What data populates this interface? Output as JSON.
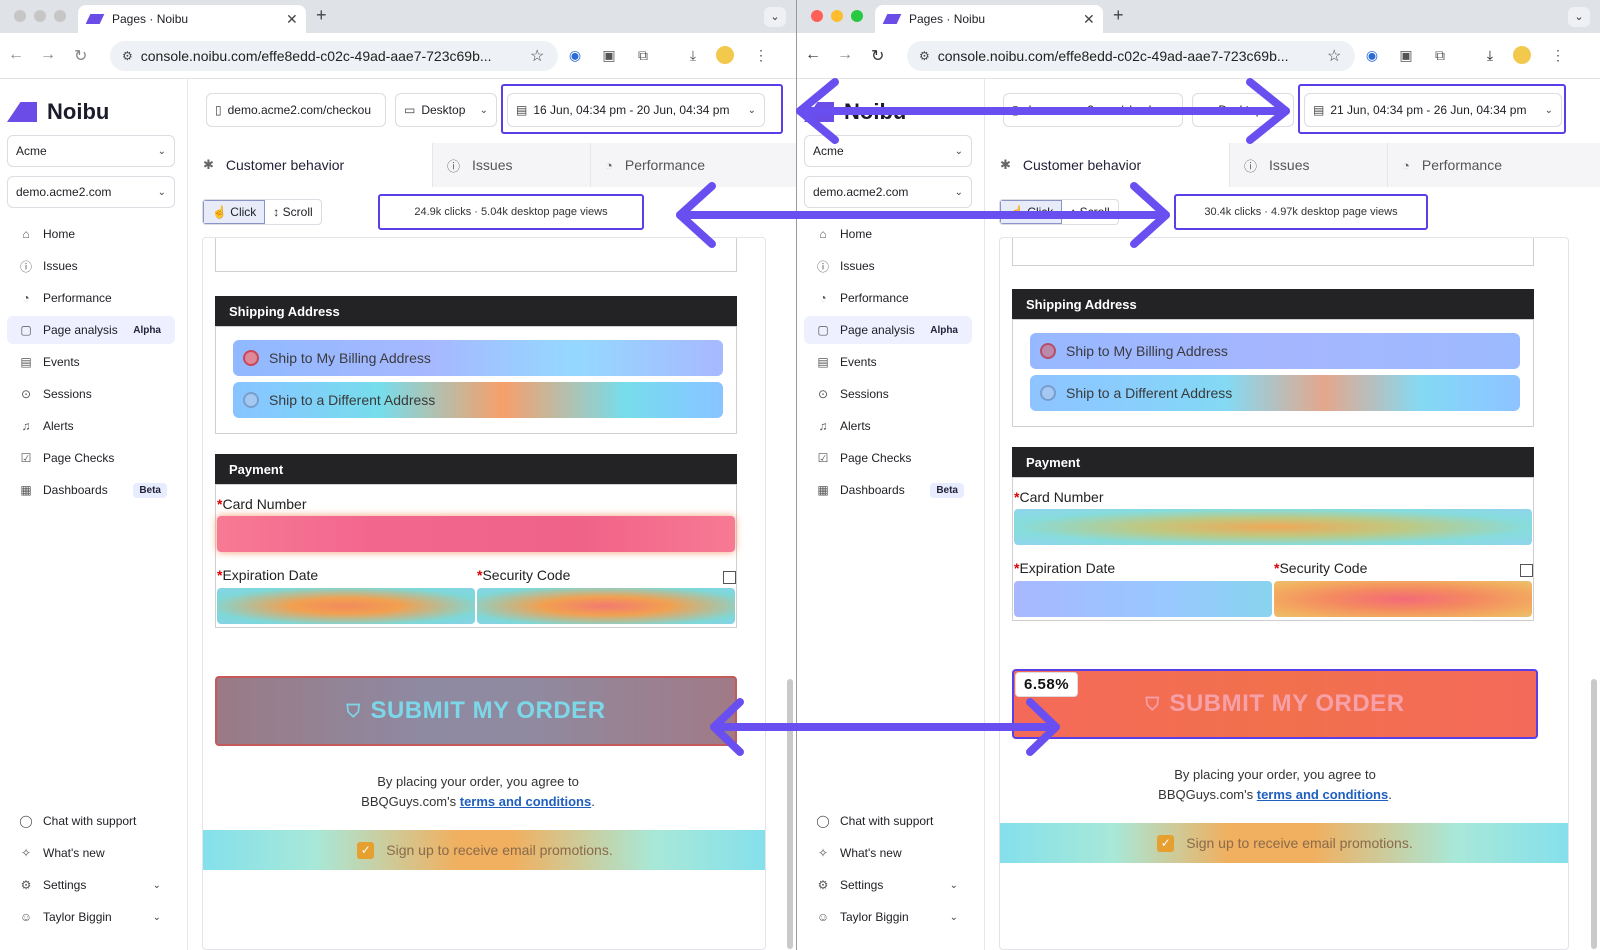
{
  "browser": {
    "tab_title": "Pages · Noibu",
    "tab_close": "✕",
    "new_tab": "+",
    "url": "console.noibu.com/effe8edd-c02c-49ad-aae7-723c69b..."
  },
  "sidebar": {
    "logo_text": "Noibu",
    "org_select": "Acme",
    "site_select": "demo.acme2.com",
    "nav": [
      {
        "label": "Home",
        "icon": "home-icon"
      },
      {
        "label": "Issues",
        "icon": "alert-circle-icon"
      },
      {
        "label": "Performance",
        "icon": "gauge-icon"
      },
      {
        "label": "Page analysis",
        "icon": "page-icon",
        "badge": "Alpha"
      },
      {
        "label": "Events",
        "icon": "calendar-icon"
      },
      {
        "label": "Sessions",
        "icon": "play-icon"
      },
      {
        "label": "Alerts",
        "icon": "bell-icon"
      },
      {
        "label": "Page Checks",
        "icon": "checklist-icon"
      },
      {
        "label": "Dashboards",
        "icon": "dashboard-icon",
        "badge": "Beta"
      }
    ],
    "bottom": [
      {
        "label": "Chat with support",
        "icon": "chat-icon"
      },
      {
        "label": "What's new",
        "icon": "sparkle-icon"
      },
      {
        "label": "Settings",
        "icon": "gear-icon"
      },
      {
        "label": "Taylor Biggin",
        "icon": "user-icon"
      }
    ]
  },
  "header": {
    "page_filter": "demo.acme2.com/checkou",
    "device_filter": "Desktop"
  },
  "left": {
    "date_range": "16 Jun, 04:34 pm - 20 Jun, 04:34 pm",
    "stats": "24.9k clicks · 5.04k desktop page views"
  },
  "right": {
    "date_range": "21 Jun, 04:34 pm - 26 Jun, 04:34 pm",
    "stats": "30.4k clicks · 4.97k desktop page views",
    "submit_percent": "6.58%"
  },
  "tabs": {
    "customer_behavior": "Customer behavior",
    "issues": "Issues",
    "performance": "Performance"
  },
  "mode_toggle": {
    "click": "Click",
    "scroll": "Scroll"
  },
  "checkout": {
    "shipping_heading": "Shipping Address",
    "ship_billing": "Ship to My Billing Address",
    "ship_different": "Ship to a Different Address",
    "payment_heading": "Payment",
    "card_number": "Card Number",
    "expiration": "Expiration Date",
    "security": "Security Code",
    "required_mark": "*",
    "submit": "SUBMIT MY ORDER",
    "agree_line1": "By placing your order, you agree to",
    "agree_prefix": "BBQGuys.com's ",
    "agree_link": "terms and conditions",
    "agree_suffix": ".",
    "promo": "Sign up to receive email promotions."
  },
  "colors": {
    "accent": "#5a3ee8",
    "brand": "#6b4ce6",
    "header_dark": "#232325"
  }
}
